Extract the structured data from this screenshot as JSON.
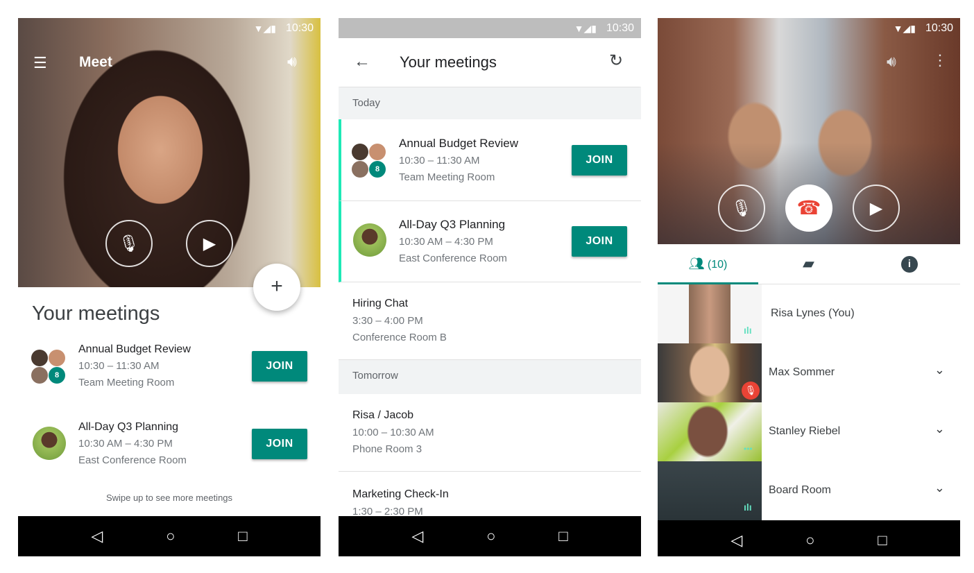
{
  "status_time": "10:30",
  "screen1": {
    "app_title": "Meet",
    "section_title": "Your meetings",
    "meetings": [
      {
        "title": "Annual Budget Review",
        "time": "10:30 – 11:30 AM",
        "room": "Team Meeting Room",
        "extra_count": "8",
        "join": "JOIN"
      },
      {
        "title": "All-Day Q3 Planning",
        "time": "10:30 AM – 4:30 PM",
        "room": "East Conference Room",
        "join": "JOIN"
      }
    ],
    "footer": "Swipe up to see more meetings",
    "fab": "+"
  },
  "screen2": {
    "app_title": "Your meetings",
    "sections": [
      {
        "label": "Today",
        "meetings": [
          {
            "title": "Annual Budget Review",
            "time": "10:30 – 11:30 AM",
            "room": "Team Meeting Room",
            "extra_count": "8",
            "join": "JOIN"
          },
          {
            "title": "All-Day Q3 Planning",
            "time": "10:30 AM – 4:30 PM",
            "room": "East Conference Room",
            "join": "JOIN"
          },
          {
            "title": "Hiring Chat",
            "time": "3:30 – 4:00 PM",
            "room": "Conference Room B"
          }
        ]
      },
      {
        "label": "Tomorrow",
        "meetings": [
          {
            "title": "Risa / Jacob",
            "time": "10:00 – 10:30 AM",
            "room": "Phone Room 3"
          },
          {
            "title": "Marketing Check-In",
            "time": "1:30 – 2:30 PM"
          }
        ]
      }
    ]
  },
  "screen3": {
    "participants_tab": "(10)",
    "participants": [
      {
        "name": "Risa Lynes (You)",
        "status": "speaking"
      },
      {
        "name": "Max Sommer",
        "status": "muted"
      },
      {
        "name": "Stanley Riebel",
        "status": "idle"
      },
      {
        "name": "Board Room",
        "status": "speaking"
      }
    ]
  },
  "colors": {
    "accent": "#00897b",
    "hangup": "#ea4335",
    "muted": "#ea4335"
  }
}
